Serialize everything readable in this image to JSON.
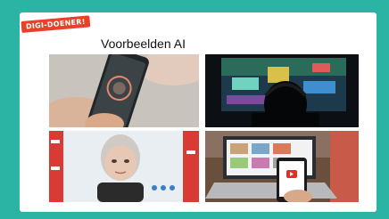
{
  "badge": {
    "label": "DIGI-DOENER!"
  },
  "slide": {
    "title": "Voorbeelden AI"
  },
  "photos": [
    {
      "icon": "phone-face-scan-photo"
    },
    {
      "icon": "gamer-at-screen-photo"
    },
    {
      "icon": "humanoid-robot-photo"
    },
    {
      "icon": "laptop-and-phone-video-photo"
    }
  ],
  "colors": {
    "frame": "#2bb3a4",
    "badge": "#e8402a",
    "slide": "#ffffff"
  }
}
